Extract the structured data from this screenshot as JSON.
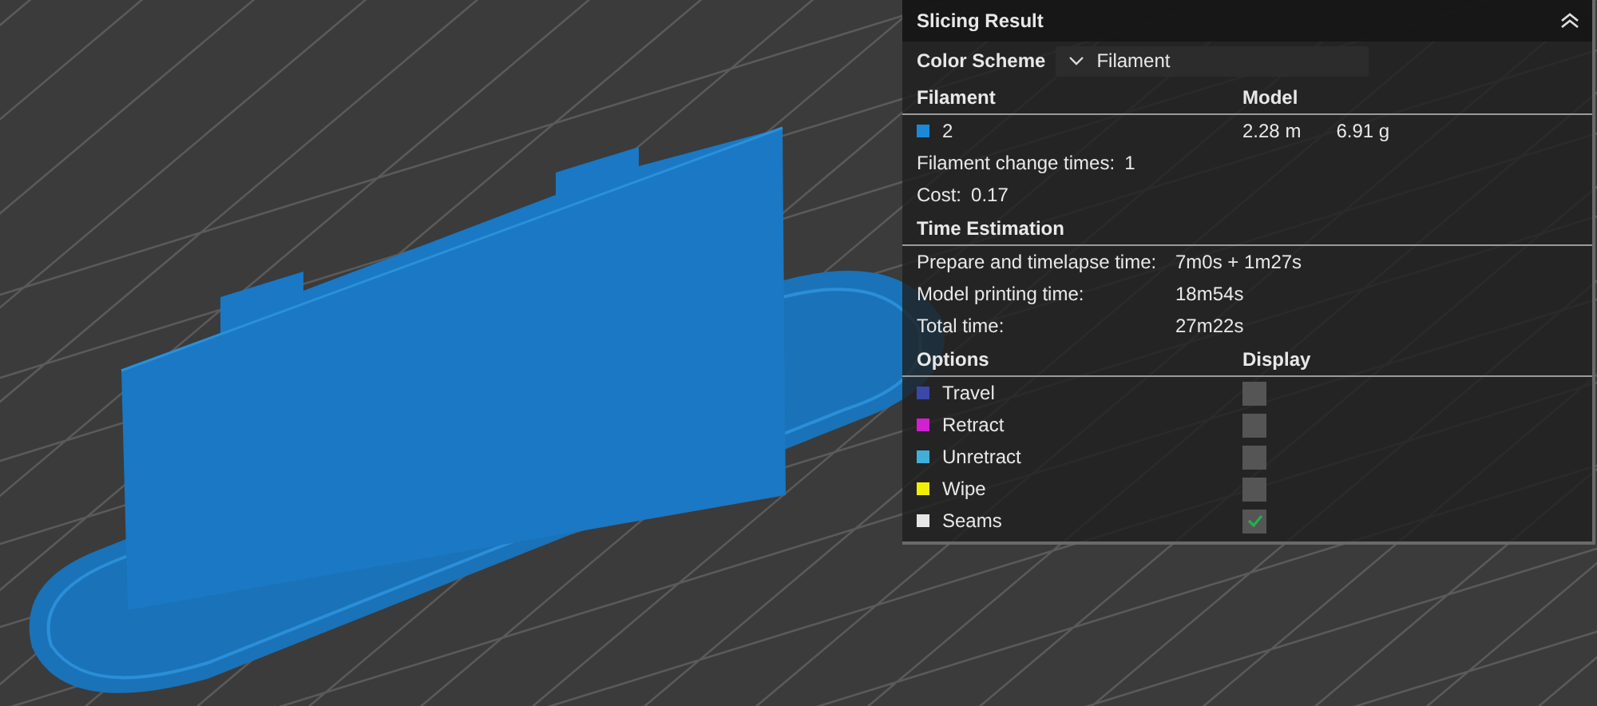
{
  "panel": {
    "title": "Slicing Result",
    "color_scheme": {
      "label": "Color Scheme",
      "value": "Filament"
    },
    "filament": {
      "headers": [
        "Filament",
        "Model"
      ],
      "rows": [
        {
          "name": "2",
          "color": "#1a8ad8",
          "length": "2.28 m",
          "weight": "6.91 g"
        }
      ],
      "change_times": {
        "label": "Filament change times:",
        "value": "1"
      },
      "cost": {
        "label": "Cost:",
        "value": "0.17"
      }
    },
    "time_estimation": {
      "title": "Time Estimation",
      "rows": [
        {
          "label": "Prepare and timelapse time:",
          "value": "7m0s + 1m27s"
        },
        {
          "label": "Model printing time:",
          "value": "18m54s"
        },
        {
          "label": "Total time:",
          "value": "27m22s"
        }
      ]
    },
    "options": {
      "headers": [
        "Options",
        "Display"
      ],
      "items": [
        {
          "name": "Travel",
          "color": "#3a48a8",
          "checked": false
        },
        {
          "name": "Retract",
          "color": "#d020d0",
          "checked": false
        },
        {
          "name": "Unretract",
          "color": "#40b0d8",
          "checked": false
        },
        {
          "name": "Wipe",
          "color": "#f0f000",
          "checked": false
        },
        {
          "name": "Seams",
          "color": "#e6e6e6",
          "checked": true
        }
      ]
    }
  }
}
